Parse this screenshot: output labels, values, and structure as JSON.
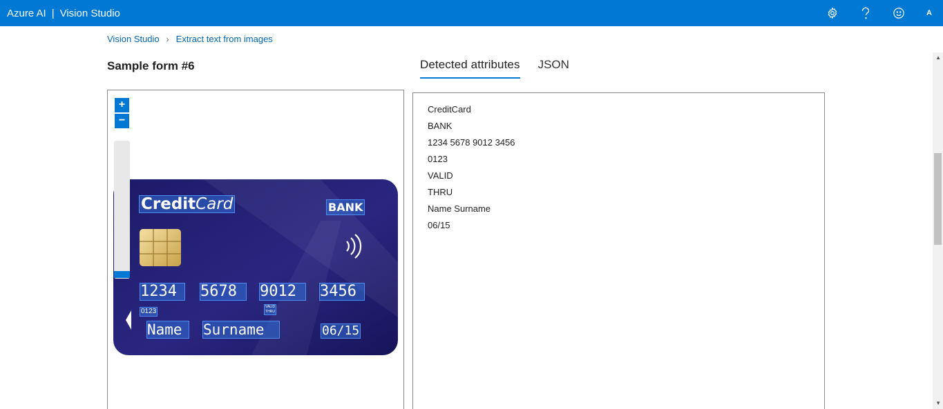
{
  "app": {
    "brand": "Azure AI",
    "separator": "|",
    "product": "Vision Studio"
  },
  "header_icons": [
    "gear-icon",
    "help-icon",
    "feedback-smiley-icon"
  ],
  "user": {
    "initial": "A"
  },
  "breadcrumb": {
    "root": "Vision Studio",
    "current": "Extract text from images"
  },
  "page": {
    "title": "Sample form #6"
  },
  "tabs": [
    {
      "label": "Detected attributes",
      "active": true
    },
    {
      "label": "JSON",
      "active": false
    }
  ],
  "zoom": {
    "in_label": "+",
    "out_label": "−"
  },
  "card": {
    "brand_bold": "Credit",
    "brand_italic": "Card",
    "bank": "BANK",
    "number_groups": [
      "1234",
      "5678",
      "9012",
      "3456"
    ],
    "small_code": "0123",
    "valid_label": "VALID",
    "thru_label": "THRU",
    "name": "Name",
    "surname": "Surname",
    "expiry": "06/15",
    "colors": {
      "background": "#1f1b6b",
      "highlight": "#2f6fd6"
    }
  },
  "results": [
    "CreditCard",
    "BANK",
    "1234 5678 9012 3456",
    "0123",
    "VALID",
    "THRU",
    "Name Surname",
    "06/15"
  ],
  "colors": {
    "accent": "#0078d4",
    "link": "#0067b8"
  }
}
